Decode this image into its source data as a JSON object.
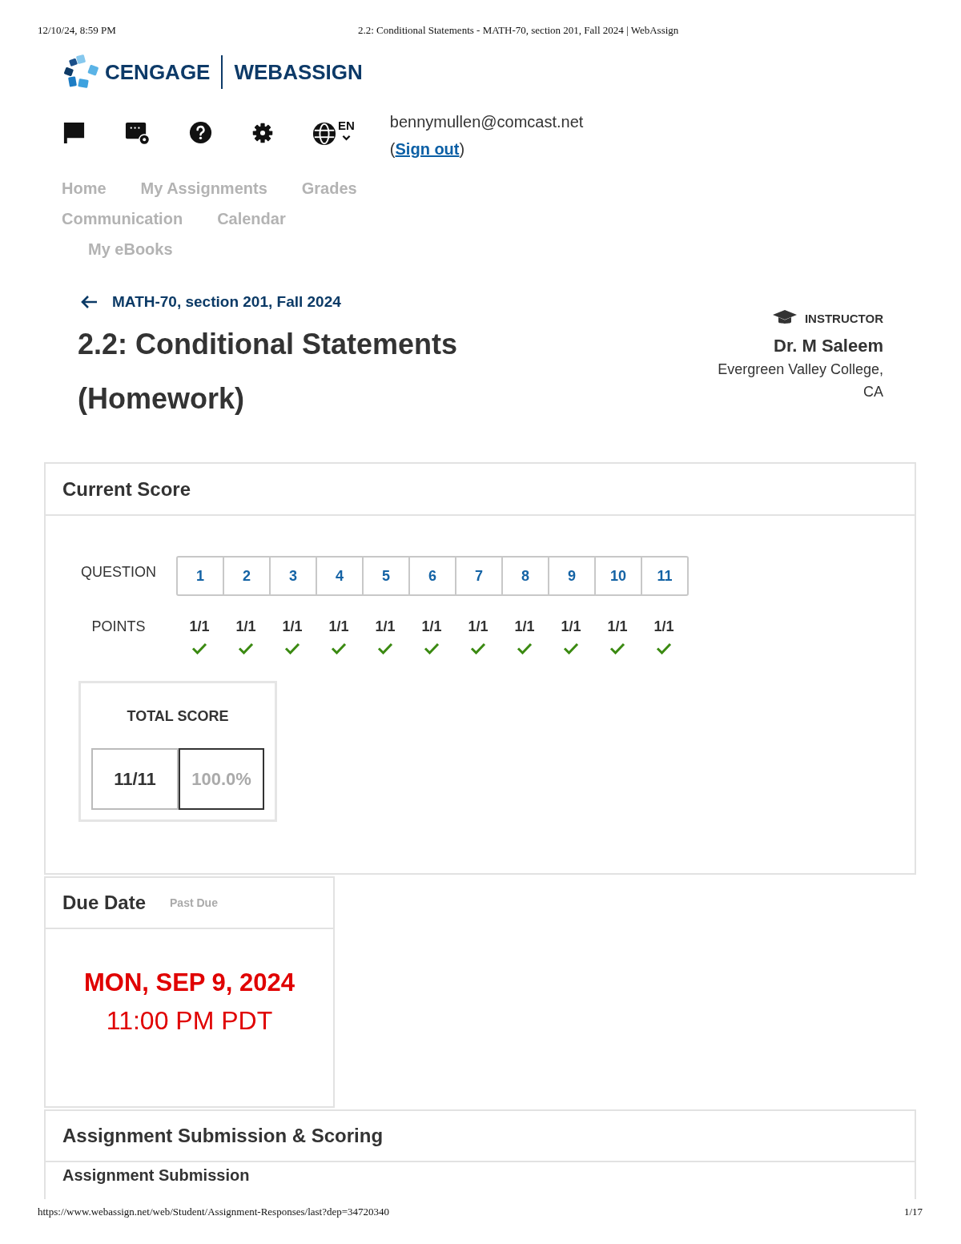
{
  "print_header": {
    "date_time": "12/10/24, 8:59 PM",
    "page_title": "2.2: Conditional Statements - MATH-70, section 201, Fall 2024 | WebAssign"
  },
  "logo": {
    "brand": "CENGAGE",
    "product": "WEBASSIGN"
  },
  "toolbar": {
    "language": "EN"
  },
  "account": {
    "email": "bennymullen@comcast.net",
    "sign_out": {
      "before": "(",
      "link": "Sign out",
      "after": ")"
    }
  },
  "nav": {
    "items": [
      {
        "label": "Home"
      },
      {
        "label": "My Assignments"
      },
      {
        "label": "Grades"
      },
      {
        "label": "Communication"
      },
      {
        "label": "Calendar"
      },
      {
        "label": "My eBooks"
      }
    ]
  },
  "course_link": "MATH-70, section 201, Fall 2024",
  "assignment_title": "2.2: Conditional Statements (Homework)",
  "instructor": {
    "label": "INSTRUCTOR",
    "name": "Dr. M Saleem",
    "school": "Evergreen Valley College, CA"
  },
  "current_score": {
    "heading": "Current Score",
    "question_label": "QUESTION",
    "points_label": "POINTS",
    "questions": [
      {
        "number": "1",
        "points": "1/1",
        "correct": true
      },
      {
        "number": "2",
        "points": "1/1",
        "correct": true
      },
      {
        "number": "3",
        "points": "1/1",
        "correct": true
      },
      {
        "number": "4",
        "points": "1/1",
        "correct": true
      },
      {
        "number": "5",
        "points": "1/1",
        "correct": true
      },
      {
        "number": "6",
        "points": "1/1",
        "correct": true
      },
      {
        "number": "7",
        "points": "1/1",
        "correct": true
      },
      {
        "number": "8",
        "points": "1/1",
        "correct": true
      },
      {
        "number": "9",
        "points": "1/1",
        "correct": true
      },
      {
        "number": "10",
        "points": "1/1",
        "correct": true
      },
      {
        "number": "11",
        "points": "1/1",
        "correct": true
      }
    ],
    "total": {
      "label": "TOTAL SCORE",
      "score": "11/11",
      "percent": "100.0%"
    }
  },
  "due_date": {
    "heading": "Due Date",
    "status": "Past Due",
    "date": "MON, SEP 9, 2024",
    "time": "11:00 PM PDT"
  },
  "submission": {
    "heading": "Assignment Submission & Scoring",
    "subheading": "Assignment Submission"
  },
  "print_footer": {
    "url": "https://www.webassign.net/web/Student/Assignment-Responses/last?dep=34720340",
    "page": "1/17"
  }
}
